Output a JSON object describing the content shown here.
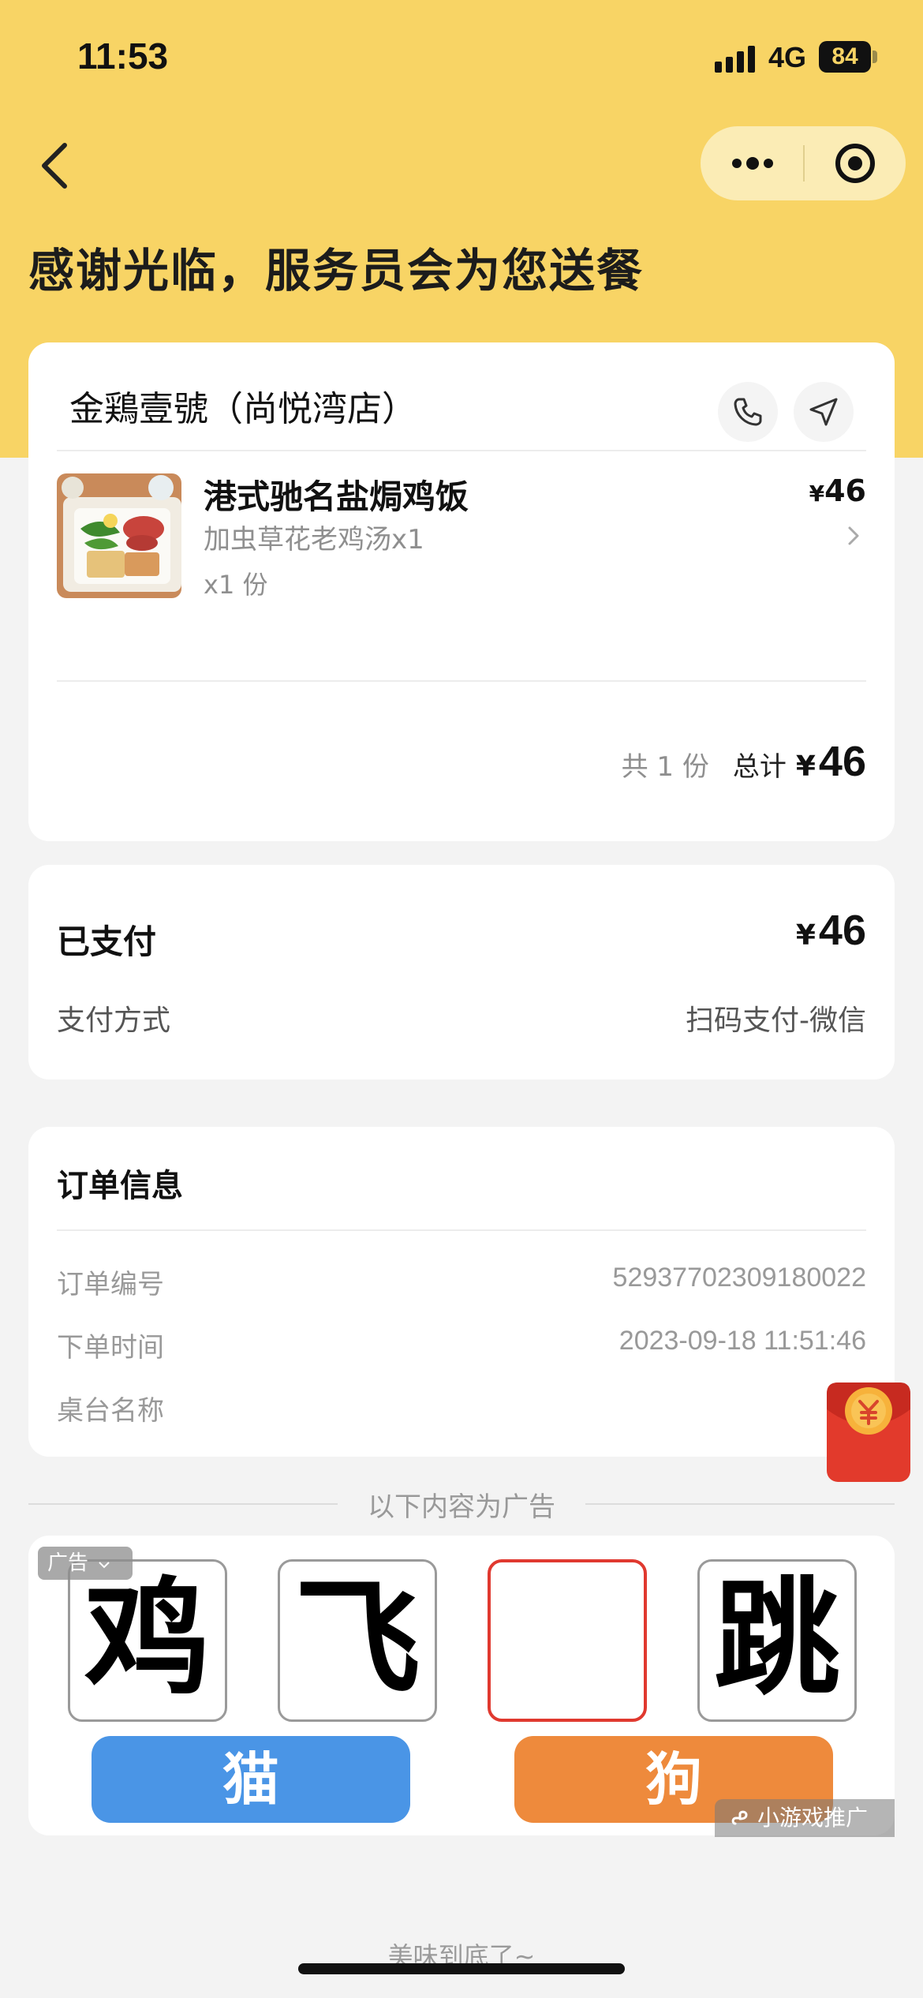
{
  "status_bar": {
    "time": "11:53",
    "network": "4G",
    "battery": "84"
  },
  "header": {
    "title": "感谢光临，服务员会为您送餐"
  },
  "store": {
    "name": "金鶏壹號（尚悦湾店）",
    "item": {
      "name": "港式驰名盐焗鸡饭",
      "addon": "加虫草花老鸡汤x1",
      "quantity": "x1 份",
      "price_symbol": "¥",
      "price": "46"
    },
    "summary": {
      "count": "共 1 份",
      "total_label": "总计",
      "currency": "¥",
      "total": "46"
    }
  },
  "payment": {
    "status": "已支付",
    "currency": "¥",
    "amount": "46",
    "method_label": "支付方式",
    "method_value": "扫码支付-微信"
  },
  "order_info": {
    "title": "订单信息",
    "rows": [
      {
        "label": "订单编号",
        "value": "52937702309180022"
      },
      {
        "label": "下单时间",
        "value": "2023-09-18 11:51:46"
      },
      {
        "label": "桌台名称",
        "value": ""
      }
    ]
  },
  "ad": {
    "divider_label": "以下内容为广告",
    "tag": "广告",
    "chars": [
      "鸡",
      "飞",
      "",
      "跳"
    ],
    "choices": [
      {
        "label": "猫",
        "color": "#4a95e6"
      },
      {
        "label": "狗",
        "color": "#ee8a3c"
      }
    ],
    "source": "小游戏推广"
  },
  "footer": {
    "text": "美味到底了~"
  },
  "colors": {
    "header_bg": "#f8d465",
    "capsule_bg": "#fbecb5",
    "page_bg": "#f3f3f3",
    "active_box_border": "#e0392f"
  }
}
